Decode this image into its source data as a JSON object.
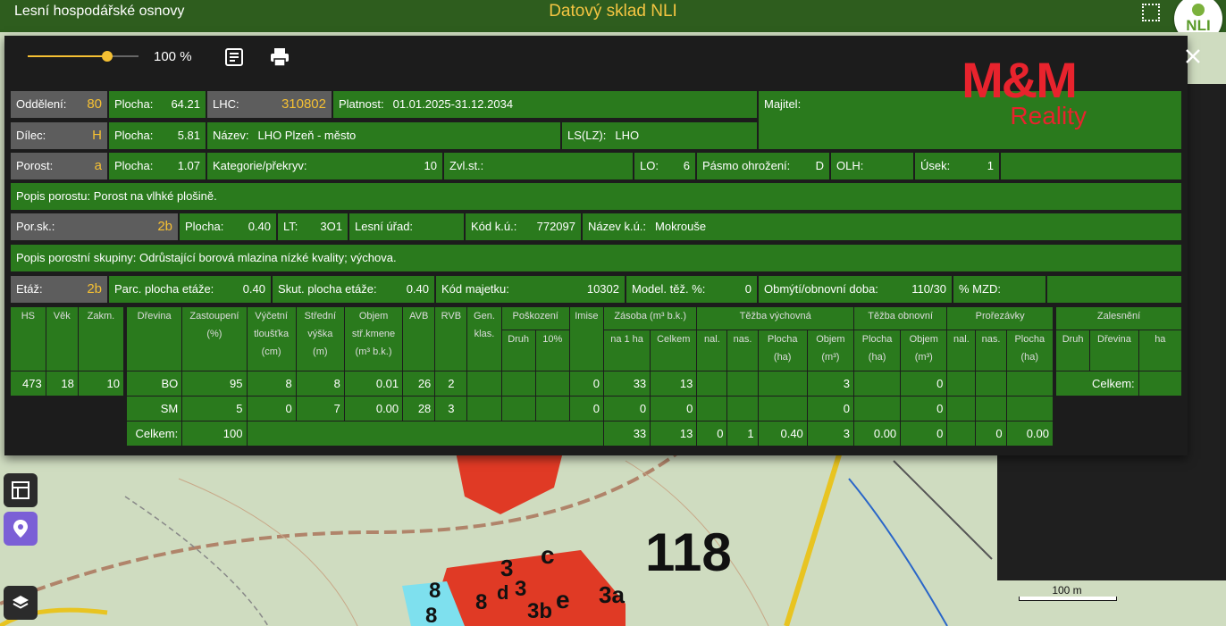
{
  "app": {
    "left_title": "Lesní hospodářské osnovy",
    "center_title": "Datový sklad NLI",
    "logo_text": "NLI"
  },
  "toolbar": {
    "zoom_label": "100 %",
    "zoom_fraction": 0.72
  },
  "watermark": {
    "brand": "M&M",
    "sub": "Reality"
  },
  "row1": {
    "oddeleni_label": "Oddělení:",
    "oddeleni_value": "80",
    "plocha_label": "Plocha:",
    "plocha_value": "64.21",
    "lhc_label": "LHC:",
    "lhc_value": "310802",
    "platnost_label": "Platnost:",
    "platnost_value": "01.01.2025-31.12.2034",
    "majitel_label": "Majitel:"
  },
  "row2": {
    "dilec_label": "Dílec:",
    "dilec_value": "H",
    "plocha_label": "Plocha:",
    "plocha_value": "5.81",
    "nazev_label": "Název:",
    "nazev_value": "LHO Plzeň - město",
    "ls_label": "LS(LZ):",
    "ls_value": "LHO"
  },
  "row3": {
    "porost_label": "Porost:",
    "porost_value": "a",
    "plocha_label": "Plocha:",
    "plocha_value": "1.07",
    "kat_label": "Kategorie/překryv:",
    "kat_value": "10",
    "zvl_label": "Zvl.st.:",
    "lo_label": "LO:",
    "lo_value": "6",
    "pasmo_label": "Pásmo ohrožení:",
    "pasmo_value": "D",
    "olh_label": "OLH:",
    "usek_label": "Úsek:",
    "usek_value": "1"
  },
  "row4": {
    "label": "Popis porostu:",
    "value": "Porost na vlhké plošině."
  },
  "row5": {
    "porsk_label": "Por.sk.:",
    "porsk_value": "2b",
    "plocha_label": "Plocha:",
    "plocha_value": "0.40",
    "lt_label": "LT:",
    "lt_value": "3O1",
    "lesni_label": "Lesní úřad:",
    "kod_label": "Kód k.ú.:",
    "kod_value": "772097",
    "nazev_label": "Název k.ú.:",
    "nazev_value": "Mokrouše"
  },
  "row6": {
    "label": "Popis porostní skupiny:",
    "value": "Odrůstající borová mlazina nízké kvality; výchova."
  },
  "row7": {
    "etaz_label": "Etáž:",
    "etaz_value": "2b",
    "parc_label": "Parc. plocha etáže:",
    "parc_value": "0.40",
    "skut_label": "Skut. plocha etáže:",
    "skut_value": "0.40",
    "kodm_label": "Kód majetku:",
    "kodm_value": "10302",
    "model_label": "Model. těž. %:",
    "model_value": "0",
    "obmyti_label": "Obmýtí/obnovní doba:",
    "obmyti_value": "110/30",
    "mzd_label": "% MZD:"
  },
  "hs_table": {
    "headers": [
      "HS",
      "Věk",
      "Zakm."
    ],
    "values": [
      "473",
      "18",
      "10"
    ]
  },
  "main_table": {
    "h": {
      "drevina": "Dřevina",
      "zast": [
        "Zastoupení",
        "(%)"
      ],
      "vycetni": [
        "Výčetní",
        "tloušťka",
        "(cm)"
      ],
      "stredni": [
        "Střední",
        "výška",
        "(m)"
      ],
      "objem": [
        "Objem",
        "stř.kmene",
        "(m³ b.k.)"
      ],
      "avb": "AVB",
      "rvb": "RVB",
      "gen": [
        "Gen.",
        "klas."
      ],
      "posk": "Poškození",
      "posk_druh": "Druh",
      "posk_10": "10%",
      "imise": "Imise",
      "zasoba": "Zásoba (m³ b.k.)",
      "na1ha": "na 1 ha",
      "celkem": "Celkem",
      "tvych": "Těžba výchovná",
      "tobn": "Těžba obnovní",
      "prorez": "Prořezávky",
      "nal": "nal.",
      "nas": "nas.",
      "plocha": [
        "Plocha",
        "(ha)"
      ],
      "objem2": [
        "Objem",
        "(m³)"
      ]
    },
    "rows": [
      {
        "drevina": "BO",
        "zast": "95",
        "vyc": "8",
        "str": "8",
        "obj": "0.01",
        "avb": "26",
        "rvb": "2",
        "imise": "0",
        "na1ha": "33",
        "celkem": "13",
        "tv_obj": "3",
        "to_obj": "0"
      },
      {
        "drevina": "SM",
        "zast": "5",
        "vyc": "0",
        "str": "7",
        "obj": "0.00",
        "avb": "28",
        "rvb": "3",
        "imise": "0",
        "na1ha": "0",
        "celkem": "0",
        "tv_obj": "0",
        "to_obj": "0"
      }
    ],
    "total": {
      "label": "Celkem:",
      "zast": "100",
      "na1ha": "33",
      "celkem": "13",
      "tv_nal": "0",
      "tv_nas": "1",
      "tv_plocha": "0.40",
      "tv_obj": "3",
      "to_plocha": "0.00",
      "to_obj": "0",
      "pr_nas": "0",
      "pr_plocha": "0.00"
    }
  },
  "zal_table": {
    "title": "Zalesnění",
    "druh": "Druh",
    "drevina": "Dřevina",
    "ha": "ha",
    "total": "Celkem:"
  },
  "map": {
    "numbers": [
      "118",
      "3",
      "c",
      "d",
      "3",
      "e",
      "3a",
      "3b",
      "8",
      "8",
      "8"
    ],
    "scale": "100 m"
  }
}
